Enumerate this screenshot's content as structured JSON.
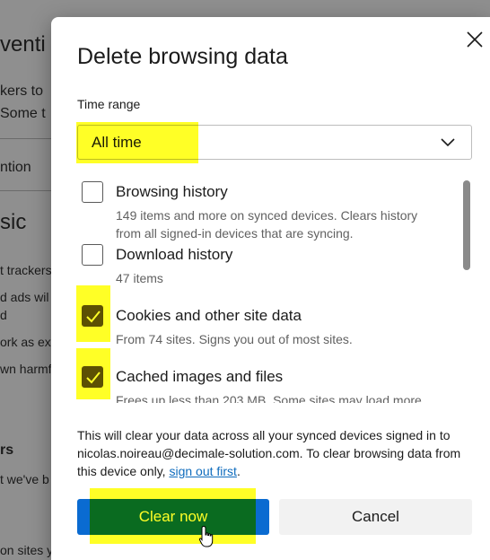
{
  "background": {
    "fragments": [
      "venti",
      "kers to",
      "Some t",
      "ntion",
      "sic",
      "t trackers",
      "d ads wil",
      "d",
      "ork as exp",
      "wn harmf",
      "rs",
      "t we've b",
      "on sites y"
    ]
  },
  "dialog": {
    "title": "Delete browsing data",
    "close_icon": "close-icon",
    "time_range": {
      "label": "Time range",
      "value": "All time",
      "icon": "chevron-down-icon"
    },
    "options": [
      {
        "title": "Browsing history",
        "description": "149 items and more on synced devices. Clears history from all signed-in devices that are syncing.",
        "checked": false
      },
      {
        "title": "Download history",
        "description": "47 items",
        "checked": false
      },
      {
        "title": "Cookies and other site data",
        "description": "From 74 sites. Signs you out of most sites.",
        "checked": true
      },
      {
        "title": "Cached images and files",
        "description": "Frees up less than 203 MB. Some sites may load more",
        "checked": true
      }
    ],
    "note": {
      "text": "This will clear your data across all your synced devices signed in to nicolas.noireau@decimale-solution.com. To clear browsing data from this device only, ",
      "link": "sign out first",
      "suffix": "."
    },
    "buttons": {
      "primary": "Clear now",
      "secondary": "Cancel"
    }
  },
  "colors": {
    "primary_button": "#0a6bd1",
    "checkbox_checked": "#5c5010",
    "highlight": "#ffff00",
    "link": "#0f6cbd"
  }
}
